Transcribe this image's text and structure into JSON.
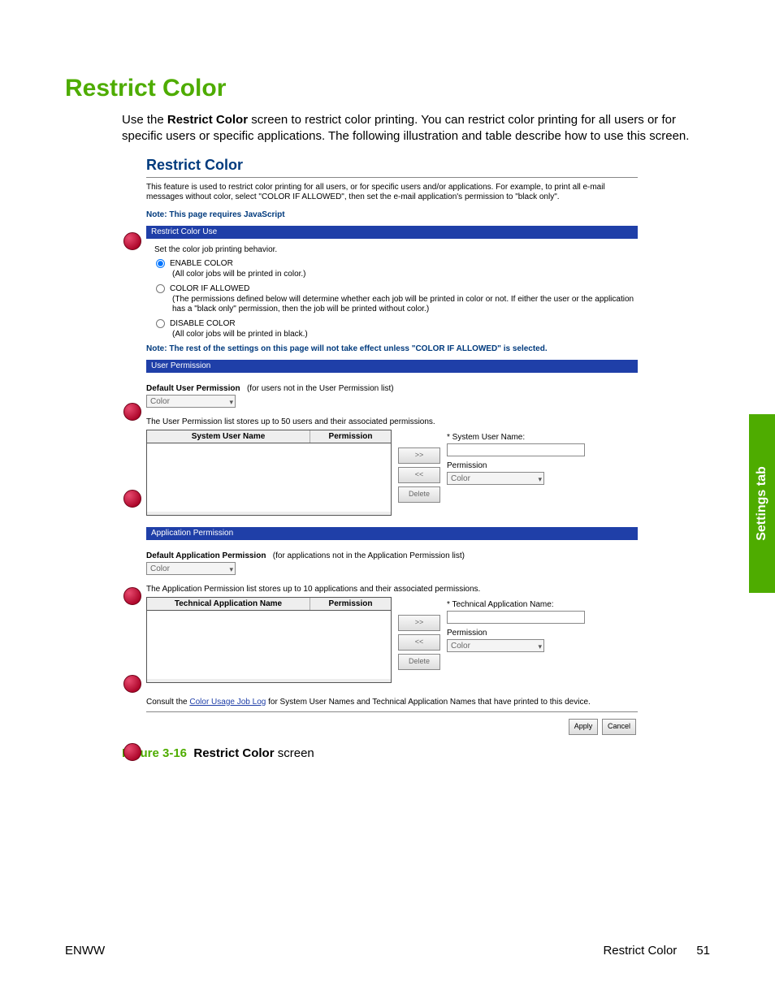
{
  "page": {
    "title": "Restrict Color",
    "intro_pre": "Use the ",
    "intro_bold": "Restrict Color",
    "intro_post": " screen to restrict color printing. You can restrict color printing for all users or for specific users or specific applications. The following illustration and table describe how to use this screen."
  },
  "screenshot": {
    "title": "Restrict Color",
    "desc": "This feature is used to restrict color printing for all users, or for specific users and/or applications. For example, to print all e-mail messages without color, select \"COLOR IF ALLOWED\", then set the e-mail application's permission to \"black only\".",
    "note_js": "Note: This page requires JavaScript",
    "sections": {
      "restrict_use": {
        "header": "Restrict Color Use",
        "lead": "Set the color job printing behavior.",
        "opts": {
          "enable": {
            "label": "ENABLE COLOR",
            "sub": "(All color jobs will be printed in color.)",
            "checked": true
          },
          "allowed": {
            "label": "COLOR IF ALLOWED",
            "sub": "(The permissions defined below will determine whether each job will be printed in color or not. If either the user or the application has a \"black only\" permission, then the job will be printed without color.)",
            "checked": false
          },
          "disable": {
            "label": "DISABLE COLOR",
            "sub": "(All color jobs will be printed in black.)",
            "checked": false
          }
        },
        "warn": "Note: The rest of the settings on this page will not take effect unless \"COLOR IF ALLOWED\" is selected."
      },
      "user_perm": {
        "header": "User Permission",
        "default_label": "Default User Permission",
        "default_hint": "(for users not in the User Permission list)",
        "select_value": "Color",
        "list_desc": "The User Permission list stores up to 50 users and their associated permissions.",
        "col1": "System User Name",
        "col2": "Permission",
        "side_label": "* System User Name:",
        "side_perm_label": "Permission",
        "side_select": "Color"
      },
      "app_perm": {
        "header": "Application Permission",
        "default_label": "Default Application Permission",
        "default_hint": "(for applications not in the Application Permission list)",
        "select_value": "Color",
        "list_desc": "The Application Permission list stores up to 10 applications and their associated permissions.",
        "col1": "Technical Application Name",
        "col2": "Permission",
        "side_label": "* Technical Application Name:",
        "side_perm_label": "Permission",
        "side_select": "Color"
      },
      "buttons": {
        "add": ">>",
        "remove": "<<",
        "delete": "Delete"
      },
      "consult_pre": "Consult the ",
      "consult_link": "Color Usage Job Log",
      "consult_post": " for System User Names and Technical Application Names that have printed to this device.",
      "apply": "Apply",
      "cancel": "Cancel"
    }
  },
  "caption": {
    "num": "Figure 3-16",
    "bold": "Restrict Color",
    "tail": " screen"
  },
  "sidetab": "Settings tab",
  "footer": {
    "left": "ENWW",
    "right_label": "Restrict Color",
    "page_no": "51"
  }
}
